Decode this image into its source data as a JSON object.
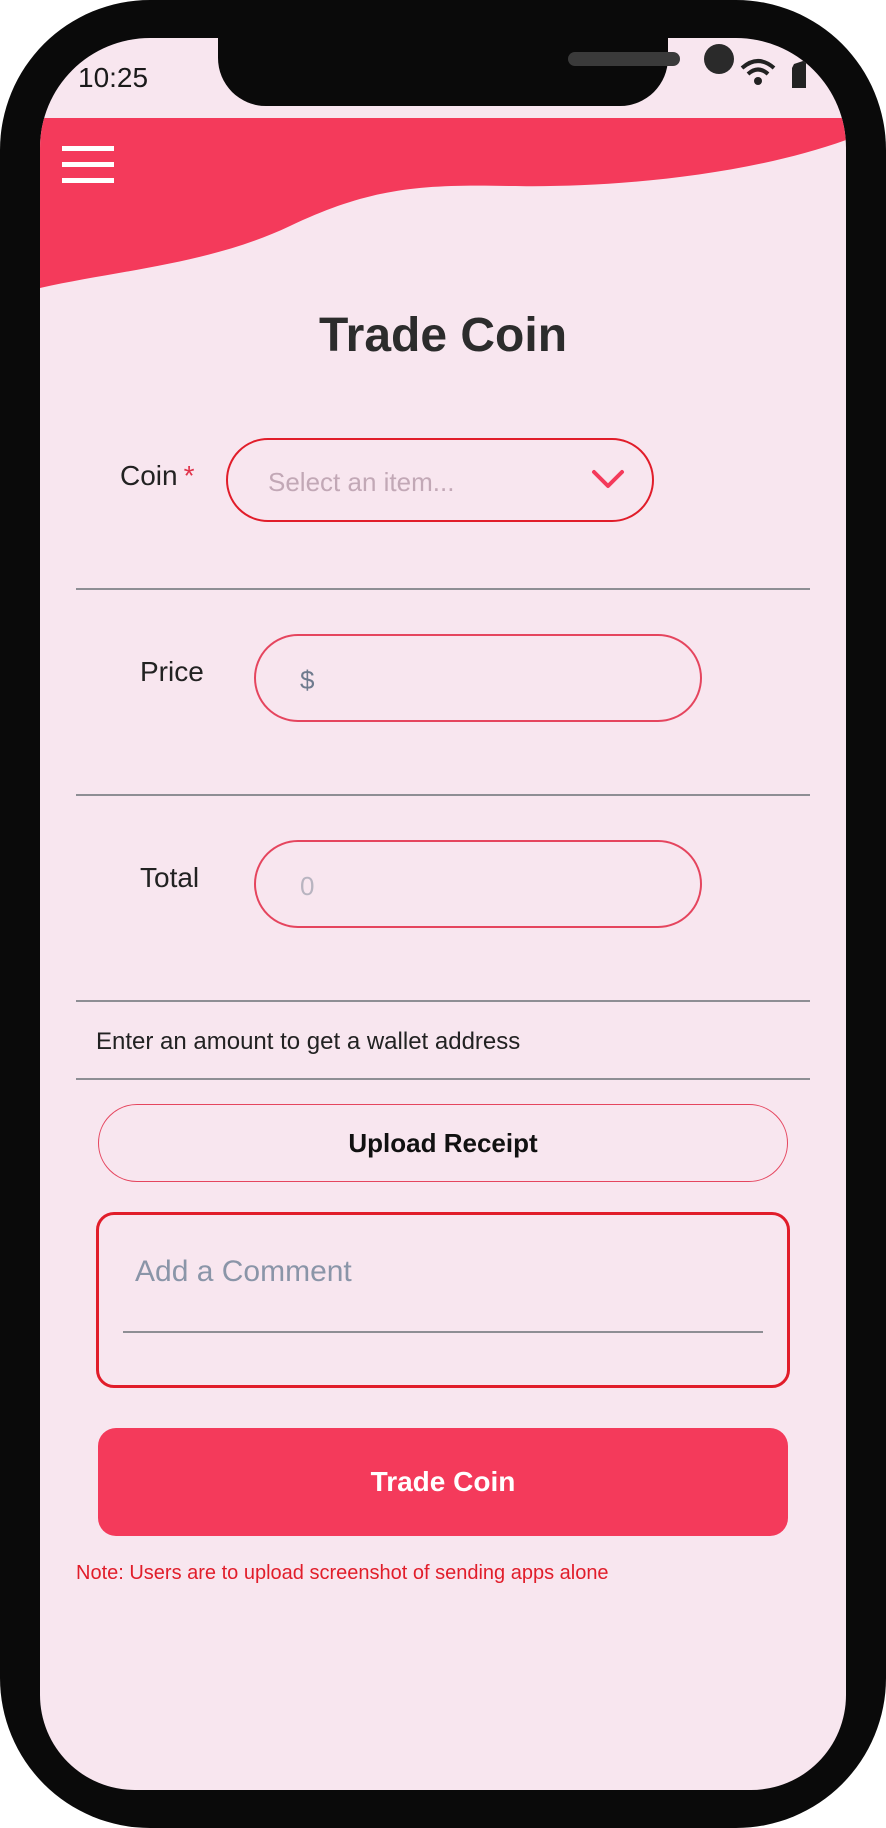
{
  "status_bar": {
    "time": "10:25",
    "icons": [
      "wifi-icon",
      "battery-icon"
    ]
  },
  "header": {
    "menu_icon": "hamburger-menu-icon",
    "accent_color": "#f43a5b"
  },
  "page": {
    "title": "Trade Coin"
  },
  "form": {
    "coin": {
      "label": "Coin",
      "required_mark": "*",
      "placeholder": "Select an item...",
      "icon": "chevron-down-icon"
    },
    "price": {
      "label": "Price",
      "prefix": "$",
      "value": ""
    },
    "total": {
      "label": "Total",
      "value": "0"
    },
    "helper_text": "Enter an amount to get a wallet address",
    "upload_label": "Upload Receipt",
    "comment_placeholder": "Add a Comment",
    "submit_label": "Trade Coin",
    "note": "Note: Users are to upload screenshot of sending apps alone"
  },
  "colors": {
    "background": "#f8e6ef",
    "field_border": "#e5455e",
    "error_border": "#e11d2a",
    "primary_button": "#f43a5b",
    "note_text": "#e11d2a"
  }
}
